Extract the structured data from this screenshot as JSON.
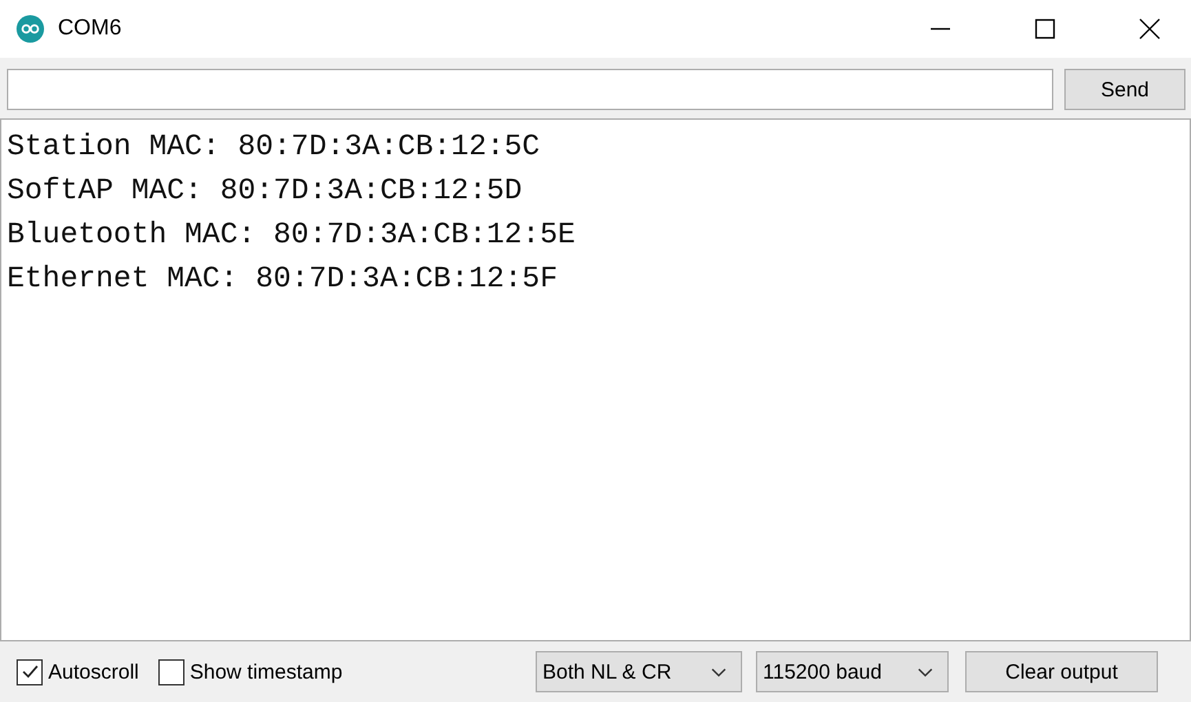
{
  "window": {
    "title": "COM6"
  },
  "send_button": "Send",
  "output_lines": [
    "Station MAC: 80:7D:3A:CB:12:5C",
    "SoftAP MAC: 80:7D:3A:CB:12:5D",
    "Bluetooth MAC: 80:7D:3A:CB:12:5E",
    "Ethernet MAC: 80:7D:3A:CB:12:5F"
  ],
  "status_bar": {
    "checkboxes": [
      {
        "label": "Autoscroll",
        "checked": true
      },
      {
        "label": "Show timestamp",
        "checked": false
      }
    ],
    "line_ending": "Both NL & CR",
    "baud_rate": "115200 baud",
    "clear_button": "Clear output"
  }
}
